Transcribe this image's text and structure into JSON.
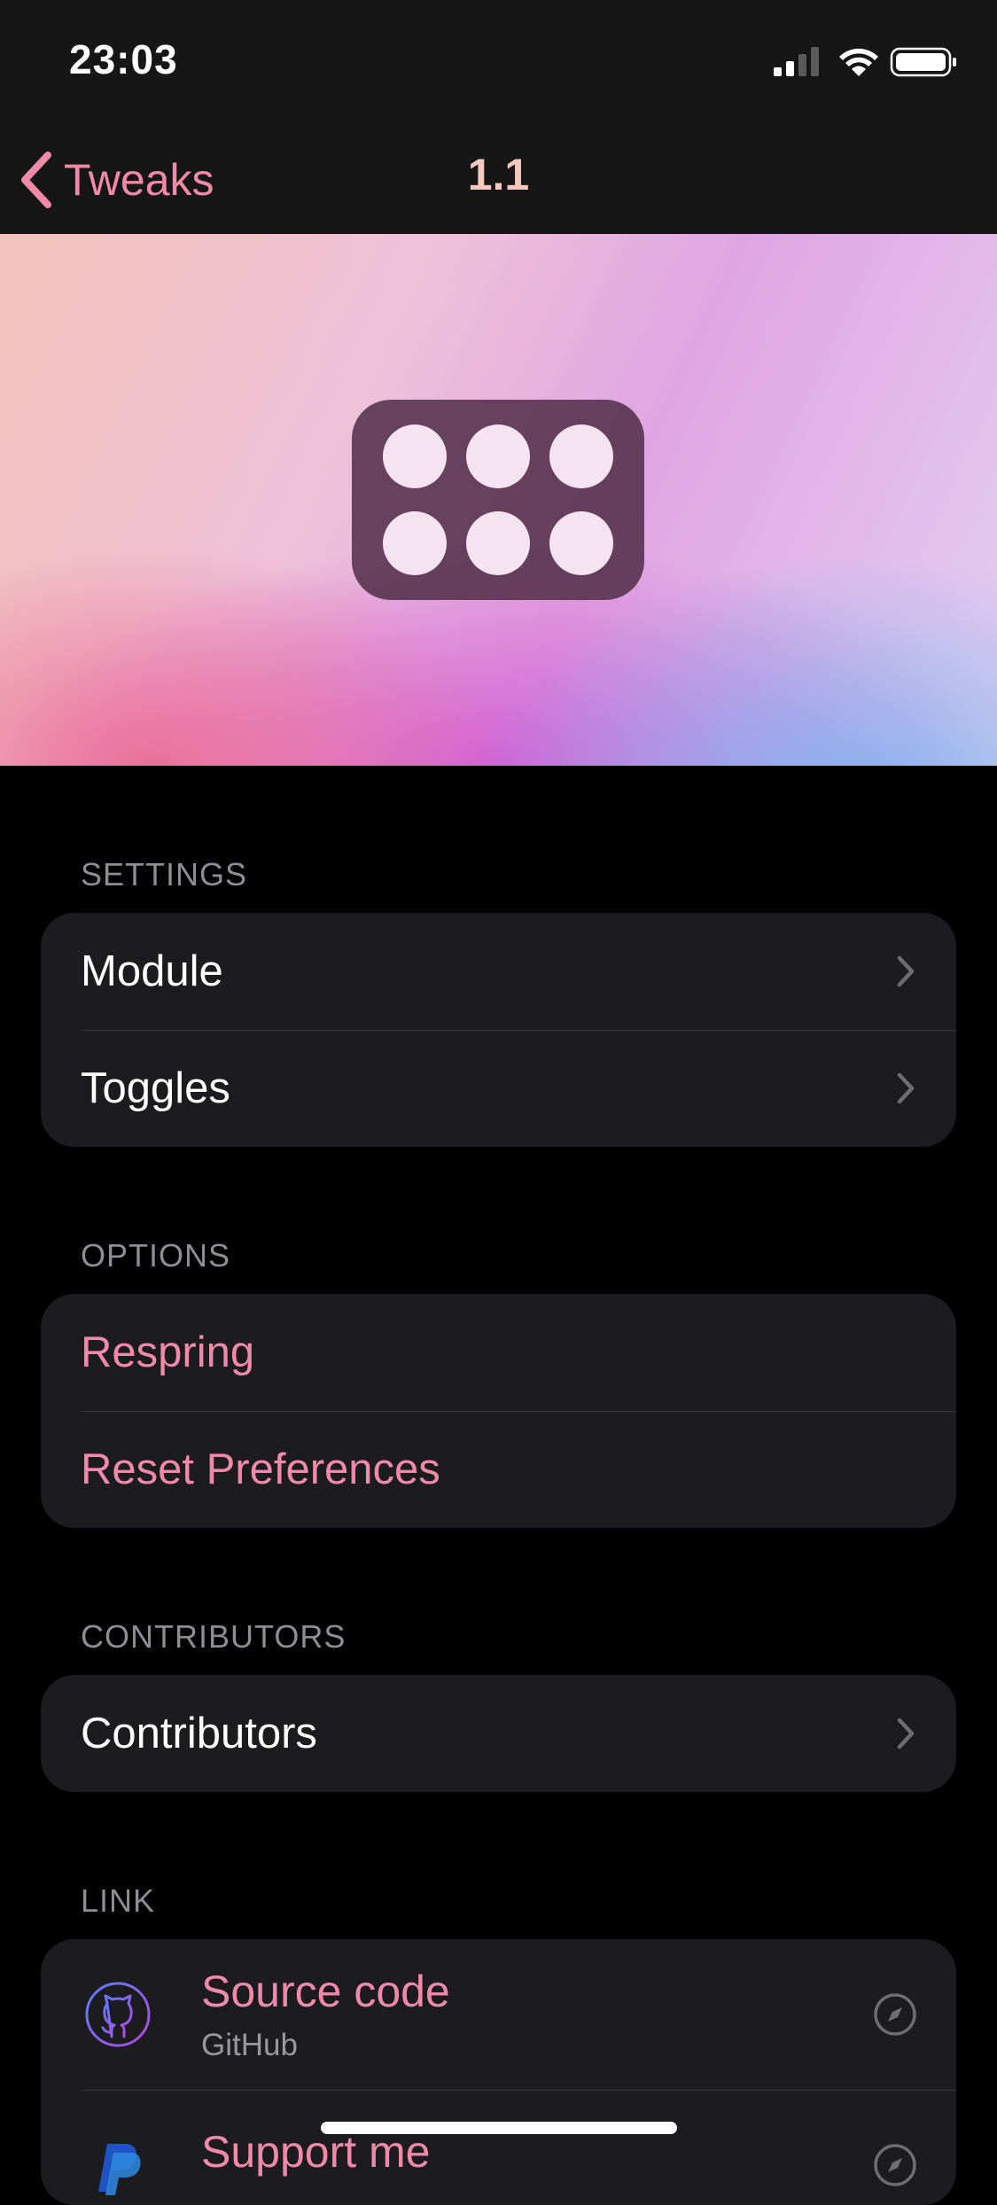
{
  "status_bar": {
    "time": "23:03"
  },
  "nav": {
    "back_label": "Tweaks",
    "title": "1.1"
  },
  "sections": {
    "settings": {
      "header": "SETTINGS",
      "rows": [
        "Module",
        "Toggles"
      ]
    },
    "options": {
      "header": "OPTIONS",
      "rows": [
        "Respring",
        "Reset Preferences"
      ]
    },
    "contributors": {
      "header": "CONTRIBUTORS",
      "rows": [
        "Contributors"
      ]
    },
    "link": {
      "header": "LINK",
      "rows": [
        {
          "title": "Source code",
          "subtitle": "GitHub",
          "icon": "github-icon"
        },
        {
          "title": "Support me",
          "subtitle": "",
          "icon": "paypal-icon"
        }
      ]
    }
  },
  "colors": {
    "accent": "#f08aa8",
    "background": "#000000",
    "cell": "#1c1c1e",
    "secondary_text": "#8d8d92"
  }
}
